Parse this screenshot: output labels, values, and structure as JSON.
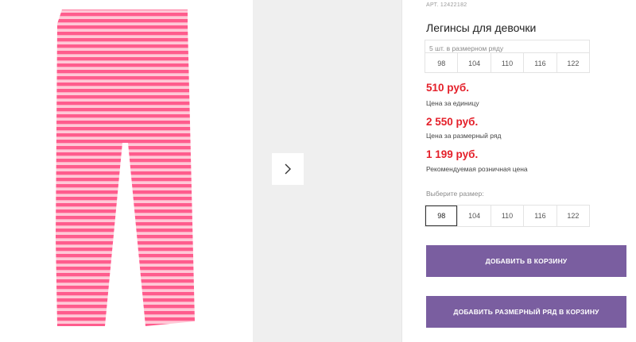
{
  "product": {
    "article": "АРТ. 12422182",
    "title": "Легинсы для девочки"
  },
  "pack": {
    "label": "5 шт. в размерном ряду",
    "sizes": [
      "98",
      "104",
      "110",
      "116",
      "122"
    ]
  },
  "prices": [
    {
      "value": "510 руб.",
      "label": "Цена за единицу"
    },
    {
      "value": "2 550 руб.",
      "label": "Цена за размерный ряд"
    },
    {
      "value": "1 199 руб.",
      "label": "Рекомендуемая розничная цена"
    }
  ],
  "size_select": {
    "label": "Выберите размер:",
    "options": [
      "98",
      "104",
      "110",
      "116",
      "122"
    ],
    "selected": "98"
  },
  "buttons": {
    "add_to_cart": "ДОБАВИТЬ В КОРЗИНУ",
    "add_pack_to_cart": "ДОБАВИТЬ РАЗМЕРНЫЙ РЯД В КОРЗИНУ"
  },
  "gallery": {
    "next_icon": "chevron-right-icon",
    "stripe_colors": [
      "#ff5f8f",
      "#ffc3d3"
    ]
  },
  "colors": {
    "price": "#e4202a",
    "button": "#7a5ea0"
  }
}
